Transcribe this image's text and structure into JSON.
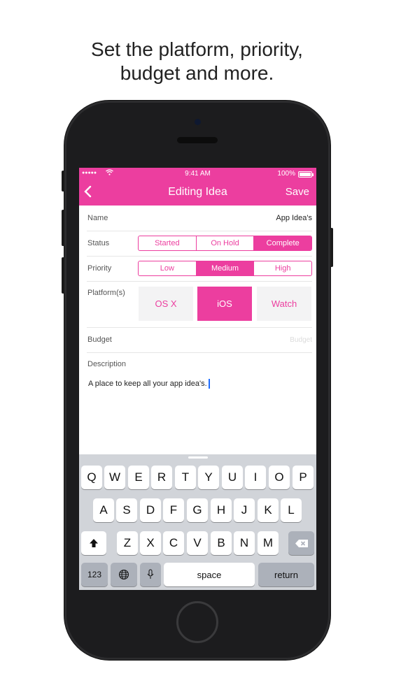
{
  "headline": {
    "line1": "Set the platform, priority,",
    "line2": "budget and more."
  },
  "status_bar": {
    "signal": "●●●●●",
    "time": "9:41 AM",
    "battery": "100%"
  },
  "nav": {
    "back": "‹",
    "title": "Editing Idea",
    "save": "Save"
  },
  "form": {
    "name": {
      "label": "Name",
      "value": "App Idea's"
    },
    "status": {
      "label": "Status",
      "options": [
        "Started",
        "On Hold",
        "Complete"
      ],
      "selected": "Complete"
    },
    "priority": {
      "label": "Priority",
      "options": [
        "Low",
        "Medium",
        "High"
      ],
      "selected": "Medium"
    },
    "platforms": {
      "label": "Platform(s)",
      "options": [
        "OS X",
        "iOS",
        "Watch"
      ],
      "selected": "iOS"
    },
    "budget": {
      "label": "Budget",
      "placeholder": "Budget"
    },
    "description": {
      "label": "Description",
      "value": "A place to keep all your app idea's."
    }
  },
  "keyboard": {
    "row1": [
      "Q",
      "W",
      "E",
      "R",
      "T",
      "Y",
      "U",
      "I",
      "O",
      "P"
    ],
    "row2": [
      "A",
      "S",
      "D",
      "F",
      "G",
      "H",
      "J",
      "K",
      "L"
    ],
    "row3": [
      "Z",
      "X",
      "C",
      "V",
      "B",
      "N",
      "M"
    ],
    "shift": "⬆",
    "delete": "⌫",
    "numbers": "123",
    "globe": "🌐",
    "mic": "🎤",
    "space": "space",
    "return": "return"
  },
  "colors": {
    "accent": "#ec3e9f",
    "keyboard_bg": "#d1d4d9"
  }
}
